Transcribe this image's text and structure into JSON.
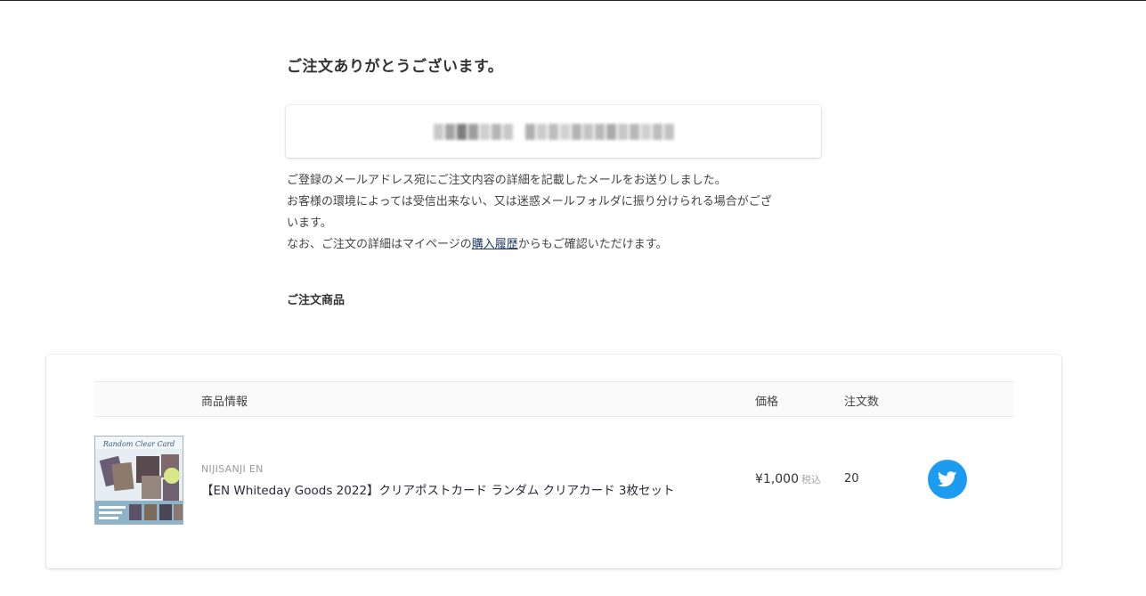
{
  "header": {
    "title": "ご注文ありがとうございます。"
  },
  "order_box": {
    "redacted": true
  },
  "message": {
    "line1": "ご登録のメールアドレス宛にご注文内容の詳細を記載したメールをお送りしました。",
    "line2": "お客様の環境によっては受信出来ない、又は迷惑メールフォルダに振り分けられる場合がござ",
    "line3": "います。",
    "line4_before": "なお、ご注文の詳細はマイページの",
    "line4_link": "購入履歴",
    "line4_after": "からもご確認いただけます。"
  },
  "section": {
    "title": "ご注文商品"
  },
  "table": {
    "headers": {
      "info": "商品情報",
      "price": "価格",
      "quantity": "注文数"
    },
    "rows": [
      {
        "thumbnail_title": "Random Clear Card",
        "brand": "NIJISANJI EN",
        "name": "【EN Whiteday Goods 2022】クリアポストカード ランダム クリアカード 3枚セット",
        "price": "¥1,000",
        "tax_label": "税込",
        "quantity": "20",
        "share_icon": "twitter-icon"
      }
    ]
  },
  "colors": {
    "twitter": "#1d9bf0",
    "link": "#1a3a66"
  }
}
